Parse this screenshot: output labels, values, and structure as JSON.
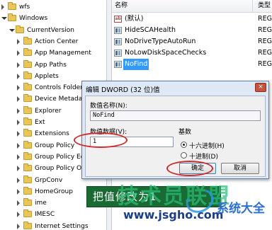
{
  "tree": {
    "items": [
      {
        "label": "wfs",
        "open": false
      },
      {
        "label": "Windows",
        "open": true
      },
      {
        "label": "CurrentVersion",
        "open": true
      },
      {
        "label": "Action Center",
        "open": false
      },
      {
        "label": "App Management",
        "open": false
      },
      {
        "label": "App Paths",
        "open": false
      },
      {
        "label": "Applets",
        "open": false
      },
      {
        "label": "Controls Folder",
        "open": false
      },
      {
        "label": "Device Metadata",
        "open": false
      },
      {
        "label": "Explorer",
        "open": false
      },
      {
        "label": "Ext",
        "open": false
      },
      {
        "label": "Extensions",
        "open": false
      },
      {
        "label": "Group Policy",
        "open": false
      },
      {
        "label": "Group Policy Ed",
        "open": false
      },
      {
        "label": "Group Policy O",
        "open": false
      },
      {
        "label": "GrpConv",
        "open": false
      },
      {
        "label": "HomeGroup",
        "open": false
      },
      {
        "label": "ime",
        "open": false
      },
      {
        "label": "IMESC",
        "open": false
      },
      {
        "label": "Internet Settings",
        "open": false
      }
    ]
  },
  "list": {
    "header_name": "名称",
    "header_type": "类型",
    "rows": [
      {
        "icon": "string-value-icon",
        "name": "(默认)",
        "type": "REG_SZ"
      },
      {
        "icon": "binary-value-icon",
        "name": "HideSCAHealth",
        "type": "REG_DWO"
      },
      {
        "icon": "binary-value-icon",
        "name": "NoDriveTypeAutoRun",
        "type": "REG_DWO"
      },
      {
        "icon": "binary-value-icon",
        "name": "NoLowDiskSpaceChecks",
        "type": "REG_DWO"
      },
      {
        "icon": "binary-value-icon",
        "name": "NoFind",
        "type": "REG_DWO"
      }
    ]
  },
  "dialog": {
    "title": "编辑 DWORD (32 位)值",
    "close_label": "×",
    "value_name_label": "数值名称(N):",
    "value_name": "NoFind",
    "value_data_label": "数值数据(V):",
    "value_data": "1",
    "base_label": "基数",
    "hex_label": "十六进制(H)",
    "dec_label": "十进制(D)",
    "selected_base": "hex",
    "ok_label": "确定",
    "cancel_label": "取消"
  },
  "overlay": {
    "caption": "把值修改为1",
    "watermark_big": "技术员联盟",
    "watermark_url": "www.jsgho.com",
    "watermark_brand": "系统大全"
  },
  "colors": {
    "selection": "#3399ff",
    "annotation": "#d12a2a",
    "caption_bg": "#1a6b33"
  }
}
